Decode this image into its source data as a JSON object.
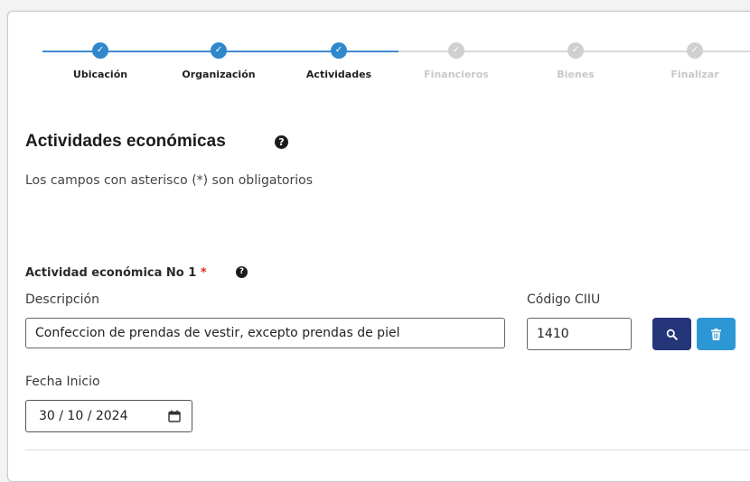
{
  "stepper": {
    "steps": [
      {
        "label": "Ubicación",
        "state": "done"
      },
      {
        "label": "Organización",
        "state": "done"
      },
      {
        "label": "Actividades",
        "state": "done"
      },
      {
        "label": "Financieros",
        "state": "todo"
      },
      {
        "label": "Bienes",
        "state": "todo"
      },
      {
        "label": "Finalizar",
        "state": "todo"
      }
    ],
    "check_glyph": "✓"
  },
  "section": {
    "title": "Actividades económicas",
    "help_glyph": "?",
    "required_note": "Los campos con asterisco (*) son obligatorios"
  },
  "activity": {
    "title": "Actividad económica No 1",
    "required_mark": "*",
    "help_glyph": "?",
    "description_label": "Descripción",
    "description_value": "Confeccion de prendas de vestir, excepto prendas de piel",
    "ciiu_label": "Código CIIU",
    "ciiu_value": "1410",
    "start_date_label": "Fecha Inicio",
    "start_date_value": "30 / 10 / 2024",
    "search_button_icon": "search-icon",
    "delete_button_icon": "trash-icon",
    "calendar_icon": "calendar-icon"
  },
  "colors": {
    "step_done": "#2f87cc",
    "step_todo": "#d0d0d0",
    "search_button": "#24357a",
    "delete_button": "#2d97d6",
    "required": "#d93025"
  }
}
